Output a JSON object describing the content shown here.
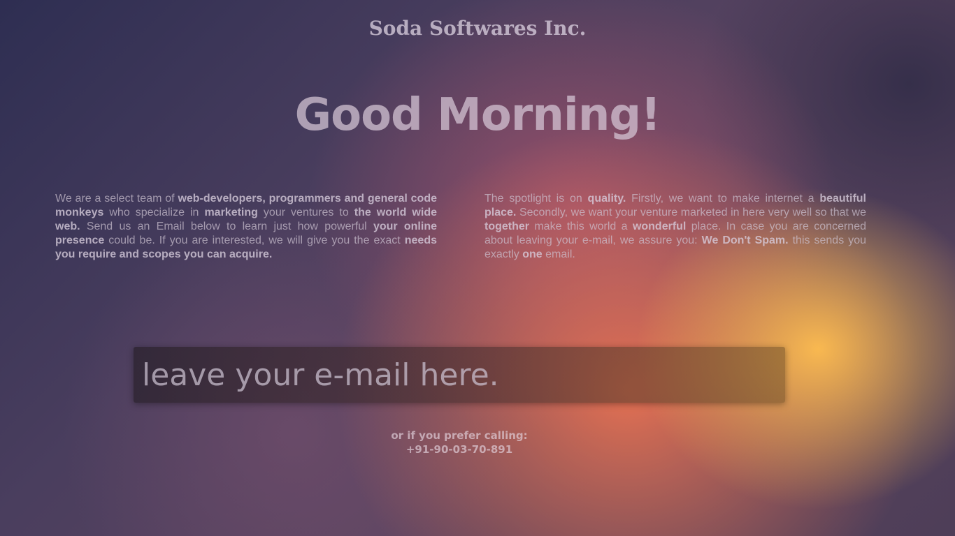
{
  "header": {
    "company_name": "Soda Softwares Inc."
  },
  "hero": {
    "greeting": "Good Morning!"
  },
  "intro": {
    "left": [
      {
        "t": "We are a select team of ",
        "b": false
      },
      {
        "t": "web-developers, programmers and general code monkeys",
        "b": true
      },
      {
        "t": " who specialize in ",
        "b": false
      },
      {
        "t": "marketing",
        "b": true
      },
      {
        "t": " your ventures to ",
        "b": false
      },
      {
        "t": "the world wide web.",
        "b": true
      },
      {
        "t": " Send us an Email below to learn just how powerful ",
        "b": false
      },
      {
        "t": "your online presence",
        "b": true
      },
      {
        "t": " could be. If you are interested, we will give you the exact ",
        "b": false
      },
      {
        "t": "needs you require and scopes you can acquire.",
        "b": true
      }
    ],
    "right": [
      {
        "t": "The spotlight is on ",
        "b": false
      },
      {
        "t": "quality.",
        "b": true
      },
      {
        "t": " Firstly, we want to make internet a ",
        "b": false
      },
      {
        "t": "beautiful place.",
        "b": true
      },
      {
        "t": " Secondly, we want your venture marketed in here very well so that we ",
        "b": false
      },
      {
        "t": "together",
        "b": true
      },
      {
        "t": " make this world a ",
        "b": false
      },
      {
        "t": "wonderful",
        "b": true
      },
      {
        "t": " place. In case you are concerned about leaving your e-mail, we assure you: ",
        "b": false
      },
      {
        "t": "We Don't Spam.",
        "b": true
      },
      {
        "t": " this sends you exactly ",
        "b": false
      },
      {
        "t": "one",
        "b": true
      },
      {
        "t": " email.",
        "b": false
      }
    ]
  },
  "signup": {
    "email_placeholder": "leave your e-mail here.",
    "email_value": ""
  },
  "contact": {
    "prompt": "or if you prefer calling:",
    "phone": "+91-90-03-70-891"
  },
  "colors": {
    "background_base": "#3a3450",
    "glow_orange": "#fa7850",
    "glow_yellow": "#ffbe50",
    "text_muted": "#cdc3d2"
  }
}
